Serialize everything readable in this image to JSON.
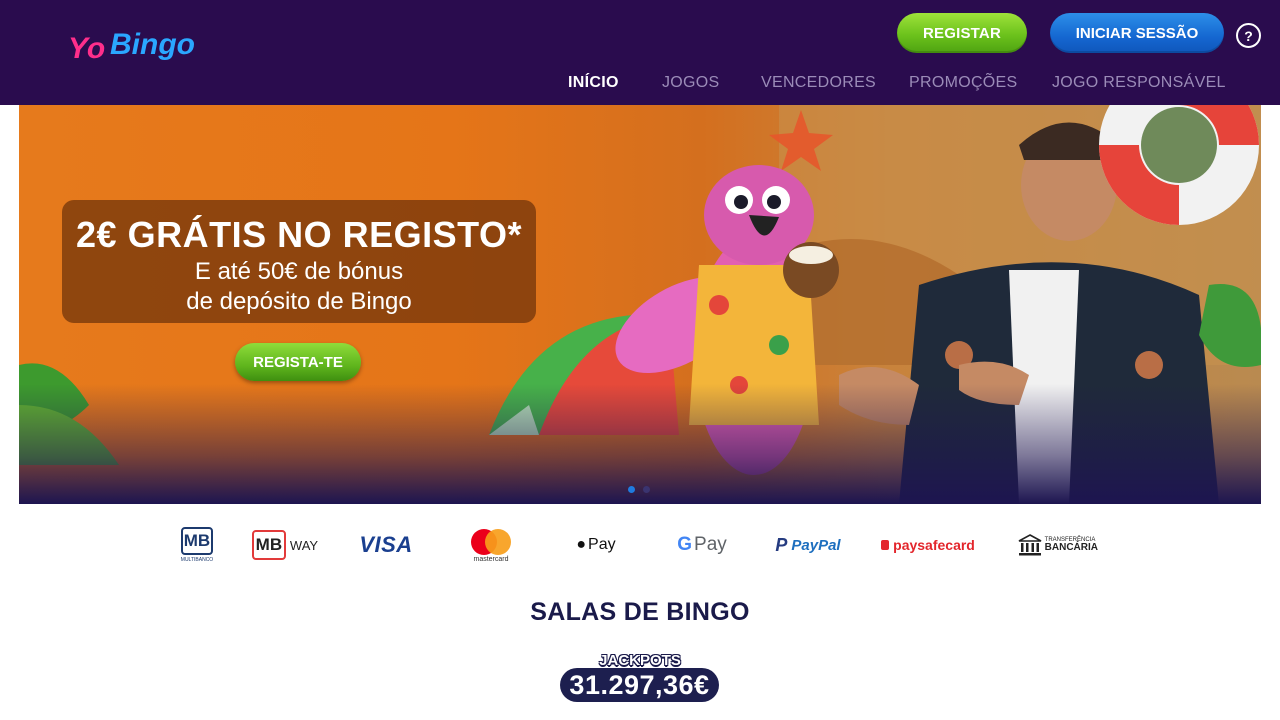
{
  "brand": {
    "logo_text": "YoBingo"
  },
  "header": {
    "register_label": "REGISTAR",
    "login_label": "INICIAR SESSÃO",
    "help_label": "?",
    "nav": [
      "INÍCIO",
      "JOGOS",
      "VENCEDORES",
      "PROMOÇÕES",
      "JOGO RESPONSÁVEL"
    ],
    "active_nav": "INÍCIO"
  },
  "hero": {
    "title": "2€ GRÁTIS NO REGISTO*",
    "line1": "E até 50€ de bónus",
    "line2": "de depósito de Bingo",
    "cta_label": "REGISTA-TE",
    "slides_total": 2,
    "active_slide": 1
  },
  "payments": {
    "mb_label": "MB",
    "mb_sub": "MULTIBANCO",
    "mbway_label": "MB",
    "mbway_way": "WAY",
    "visa_label": "VISA",
    "mastercard_sub": "mastercard",
    "applepay_label": "Pay",
    "gpay_label": "Pay",
    "paypal_label": "PayPal",
    "paysafe_label": "paysafecard",
    "transfer_top": "TRANSFERÊNCIA",
    "transfer_bottom": "BANCÁRIA"
  },
  "section": {
    "title": "SALAS DE BINGO",
    "jackpot_label": "JACKPOTS",
    "jackpot_value": "31.297,36€"
  },
  "colors": {
    "header_bg": "#2a0c4e",
    "register_green": "#6cc21c",
    "login_blue": "#1567d1",
    "hero_orange": "#e67a1c",
    "navy": "#1a1a4a"
  }
}
